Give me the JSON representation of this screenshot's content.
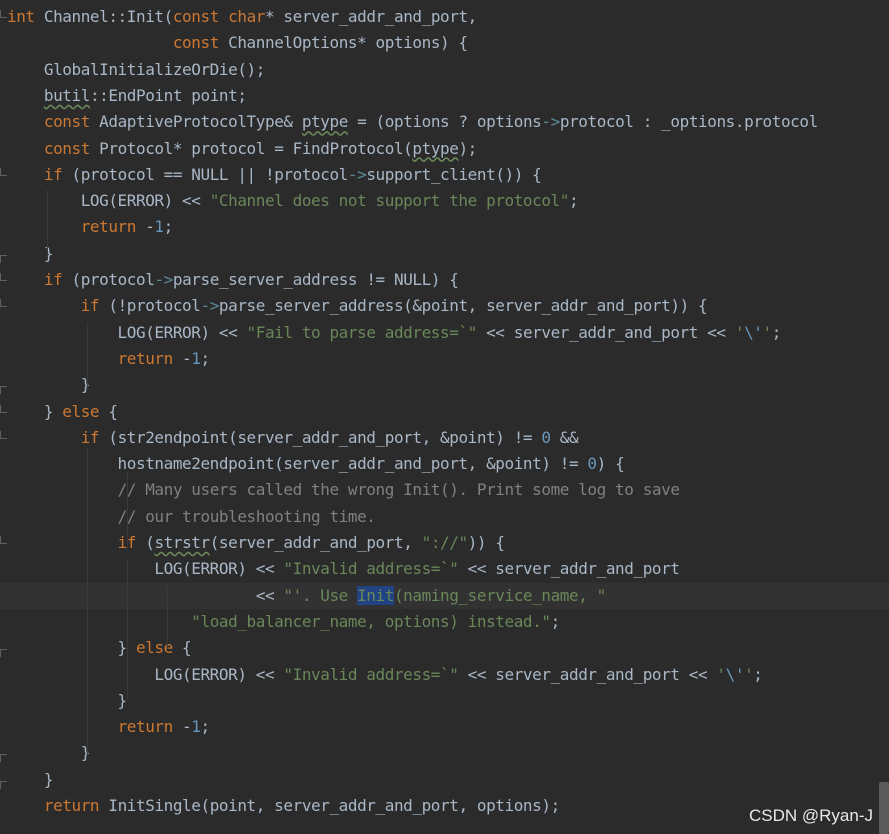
{
  "editor": {
    "lines": [
      [
        {
          "t": "int",
          "c": "kw"
        },
        {
          "t": " Channel::Init(",
          "c": "id"
        },
        {
          "t": "const",
          "c": "kw"
        },
        {
          "t": " ",
          "c": "id"
        },
        {
          "t": "char",
          "c": "kw"
        },
        {
          "t": "* server_addr_and_port,",
          "c": "id"
        }
      ],
      [
        {
          "t": "                  ",
          "c": "id"
        },
        {
          "t": "const",
          "c": "kw"
        },
        {
          "t": " ChannelOptions* options) {",
          "c": "id"
        }
      ],
      [
        {
          "t": "    GlobalInitializeOrDie();",
          "c": "id"
        }
      ],
      [
        {
          "t": "    ",
          "c": "id"
        },
        {
          "t": "butil",
          "c": "id warn"
        },
        {
          "t": "::EndPoint point;",
          "c": "id"
        }
      ],
      [
        {
          "t": "    ",
          "c": "id"
        },
        {
          "t": "const",
          "c": "kw"
        },
        {
          "t": " AdaptiveProtocolType& ",
          "c": "id"
        },
        {
          "t": "ptype",
          "c": "id warn"
        },
        {
          "t": " = (options ? options",
          "c": "id"
        },
        {
          "t": "->",
          "c": "arrow"
        },
        {
          "t": "protocol : _options.protocol",
          "c": "id"
        }
      ],
      [
        {
          "t": "    ",
          "c": "id"
        },
        {
          "t": "const",
          "c": "kw"
        },
        {
          "t": " Protocol* protocol = FindProtocol(",
          "c": "id"
        },
        {
          "t": "ptype",
          "c": "id warn"
        },
        {
          "t": ");",
          "c": "id"
        }
      ],
      [
        {
          "t": "    ",
          "c": "id"
        },
        {
          "t": "if",
          "c": "kw"
        },
        {
          "t": " (protocol == NULL || !protocol",
          "c": "id"
        },
        {
          "t": "->",
          "c": "arrow"
        },
        {
          "t": "support_client()) {",
          "c": "id"
        }
      ],
      [
        {
          "t": "        LOG(ERROR) << ",
          "c": "id"
        },
        {
          "t": "\"Channel does not support the protocol\"",
          "c": "str"
        },
        {
          "t": ";",
          "c": "id"
        }
      ],
      [
        {
          "t": "        ",
          "c": "id"
        },
        {
          "t": "return",
          "c": "kw"
        },
        {
          "t": " -",
          "c": "id"
        },
        {
          "t": "1",
          "c": "num"
        },
        {
          "t": ";",
          "c": "id"
        }
      ],
      [
        {
          "t": "    }",
          "c": "id"
        }
      ],
      [
        {
          "t": "    ",
          "c": "id"
        },
        {
          "t": "if",
          "c": "kw"
        },
        {
          "t": " (protocol",
          "c": "id"
        },
        {
          "t": "->",
          "c": "arrow"
        },
        {
          "t": "parse_server_address != NULL) {",
          "c": "id"
        }
      ],
      [
        {
          "t": "        ",
          "c": "id"
        },
        {
          "t": "if",
          "c": "kw"
        },
        {
          "t": " (!protocol",
          "c": "id"
        },
        {
          "t": "->",
          "c": "arrow"
        },
        {
          "t": "parse_server_address(&point, server_addr_and_port)) {",
          "c": "id"
        }
      ],
      [
        {
          "t": "            LOG(ERROR) << ",
          "c": "id"
        },
        {
          "t": "\"Fail to parse address=`\"",
          "c": "str"
        },
        {
          "t": " << server_addr_and_port << ",
          "c": "id"
        },
        {
          "t": "'",
          "c": "str"
        },
        {
          "t": "\\'",
          "c": "esc"
        },
        {
          "t": "'",
          "c": "str"
        },
        {
          "t": ";",
          "c": "id"
        }
      ],
      [
        {
          "t": "            ",
          "c": "id"
        },
        {
          "t": "return",
          "c": "kw"
        },
        {
          "t": " -",
          "c": "id"
        },
        {
          "t": "1",
          "c": "num"
        },
        {
          "t": ";",
          "c": "id"
        }
      ],
      [
        {
          "t": "        }",
          "c": "id"
        }
      ],
      [
        {
          "t": "    } ",
          "c": "id"
        },
        {
          "t": "else",
          "c": "kw"
        },
        {
          "t": " {",
          "c": "id"
        }
      ],
      [
        {
          "t": "        ",
          "c": "id"
        },
        {
          "t": "if",
          "c": "kw"
        },
        {
          "t": " (str2endpoint(server_addr_and_port, &point) != ",
          "c": "id"
        },
        {
          "t": "0",
          "c": "num"
        },
        {
          "t": " &&",
          "c": "id"
        }
      ],
      [
        {
          "t": "            hostname2endpoint(server_addr_and_port, &point) != ",
          "c": "id"
        },
        {
          "t": "0",
          "c": "num"
        },
        {
          "t": ") {",
          "c": "id"
        }
      ],
      [
        {
          "t": "            ",
          "c": "id"
        },
        {
          "t": "// Many users called the wrong Init(). Print some log to save",
          "c": "cmt"
        }
      ],
      [
        {
          "t": "            ",
          "c": "id"
        },
        {
          "t": "// our troubleshooting time.",
          "c": "cmt"
        }
      ],
      [
        {
          "t": "            ",
          "c": "id"
        },
        {
          "t": "if",
          "c": "kw"
        },
        {
          "t": " (",
          "c": "id"
        },
        {
          "t": "strstr",
          "c": "id warn"
        },
        {
          "t": "(server_addr_and_port, ",
          "c": "id"
        },
        {
          "t": "\"://\"",
          "c": "str"
        },
        {
          "t": ")) {",
          "c": "id"
        }
      ],
      [
        {
          "t": "                LOG(ERROR) << ",
          "c": "id"
        },
        {
          "t": "\"Invalid address=`\"",
          "c": "str"
        },
        {
          "t": " << server_addr_and_port",
          "c": "id"
        }
      ],
      [
        {
          "t": "                           << ",
          "c": "id"
        },
        {
          "t": "\"'. Use ",
          "c": "str"
        },
        {
          "t": "Init",
          "c": "str hl"
        },
        {
          "t": "(naming_service_name, \"",
          "c": "str"
        }
      ],
      [
        {
          "t": "                    ",
          "c": "id"
        },
        {
          "t": "\"load_balancer_name, options) instead.\"",
          "c": "str"
        },
        {
          "t": ";",
          "c": "id"
        }
      ],
      [
        {
          "t": "            } ",
          "c": "id"
        },
        {
          "t": "else",
          "c": "kw"
        },
        {
          "t": " {",
          "c": "id"
        }
      ],
      [
        {
          "t": "                LOG(ERROR) << ",
          "c": "id"
        },
        {
          "t": "\"Invalid address=`\"",
          "c": "str"
        },
        {
          "t": " << server_addr_and_port << ",
          "c": "id"
        },
        {
          "t": "'",
          "c": "str"
        },
        {
          "t": "\\'",
          "c": "esc"
        },
        {
          "t": "'",
          "c": "str"
        },
        {
          "t": ";",
          "c": "id"
        }
      ],
      [
        {
          "t": "            }",
          "c": "id"
        }
      ],
      [
        {
          "t": "            ",
          "c": "id"
        },
        {
          "t": "return",
          "c": "kw"
        },
        {
          "t": " -",
          "c": "id"
        },
        {
          "t": "1",
          "c": "num"
        },
        {
          "t": ";",
          "c": "id"
        }
      ],
      [
        {
          "t": "        }",
          "c": "id"
        }
      ],
      [
        {
          "t": "    }",
          "c": "id"
        }
      ],
      [
        {
          "t": "    ",
          "c": "id"
        },
        {
          "t": "return",
          "c": "kw"
        },
        {
          "t": " InitSingle(point, server_addr_and_port, options);",
          "c": "id"
        }
      ]
    ],
    "current_line": 22,
    "highlighted_word": "Init"
  },
  "watermark": "CSDN @Ryan-J",
  "colors": {
    "background": "#2b2b2b",
    "keyword": "#cc7832",
    "string": "#6a8759",
    "number": "#6897bb",
    "comment": "#808080",
    "text": "#a9b7c6",
    "selection": "#214283"
  }
}
